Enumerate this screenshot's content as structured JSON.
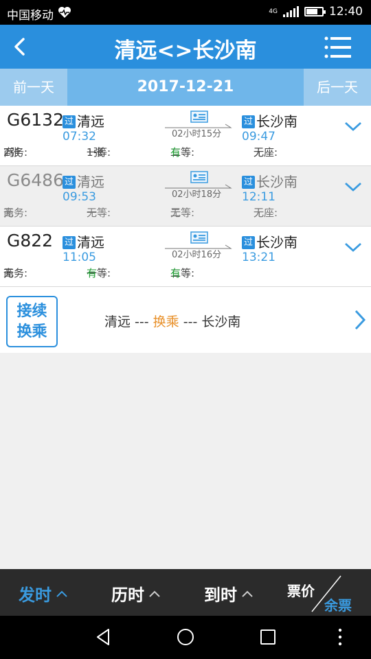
{
  "status_bar": {
    "carrier": "中国移动",
    "time": "12:40"
  },
  "header": {
    "title": "清远<>长沙南"
  },
  "datebar": {
    "prev": "前一天",
    "date": "2017-12-21",
    "next": "后一天"
  },
  "trains": [
    {
      "number": "G6132",
      "from": "清远",
      "dep": "07:32",
      "duration": "02小时15分",
      "to": "长沙南",
      "arr": "09:47",
      "pass_tag": "过",
      "business": "商务:",
      "business_val": "2张",
      "first": "一等:",
      "first_val": "1张",
      "second": "二等:",
      "second_val": "有",
      "none": "无座:",
      "none_val": "无"
    },
    {
      "number": "G6486",
      "from": "清远",
      "dep": "09:53",
      "duration": "02小时18分",
      "to": "长沙南",
      "arr": "12:11",
      "pass_tag": "过",
      "business": "商务:",
      "business_val": "无",
      "first": "一等:",
      "first_val": "无",
      "second": "二等:",
      "second_val": "无",
      "none": "无座:",
      "none_val": "无"
    },
    {
      "number": "G822",
      "from": "清远",
      "dep": "11:05",
      "duration": "02小时16分",
      "to": "长沙南",
      "arr": "13:21",
      "pass_tag": "过",
      "business": "商务:",
      "business_val": "无",
      "first": "一等:",
      "first_val": "有",
      "second": "二等:",
      "second_val": "有"
    }
  ],
  "transfer": {
    "badge_line1": "接续",
    "badge_line2": "换乘",
    "from": "清远",
    "sep1": " --- ",
    "mid": "换乘",
    "sep2": " --- ",
    "to": "长沙南"
  },
  "sortbar": {
    "dep": "发时",
    "duration": "历时",
    "arr": "到时",
    "price": "票价",
    "remaining": "余票"
  },
  "colors": {
    "primary": "#2a8fdd",
    "available": "#1a9a2e",
    "transfer_mid": "#e8902a"
  }
}
